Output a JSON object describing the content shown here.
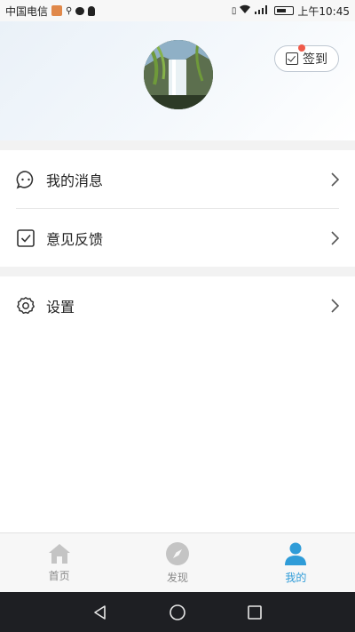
{
  "status_bar": {
    "carrier": "中国电信",
    "time": "上午10:45"
  },
  "header": {
    "checkin_label": "签到"
  },
  "menu": {
    "messages_label": "我的消息",
    "feedback_label": "意见反馈",
    "settings_label": "设置"
  },
  "tabbar": {
    "home_label": "首页",
    "discover_label": "发现",
    "mine_label": "我的",
    "active_color": "#2f9cd8",
    "inactive_color": "#bfbfbf"
  }
}
